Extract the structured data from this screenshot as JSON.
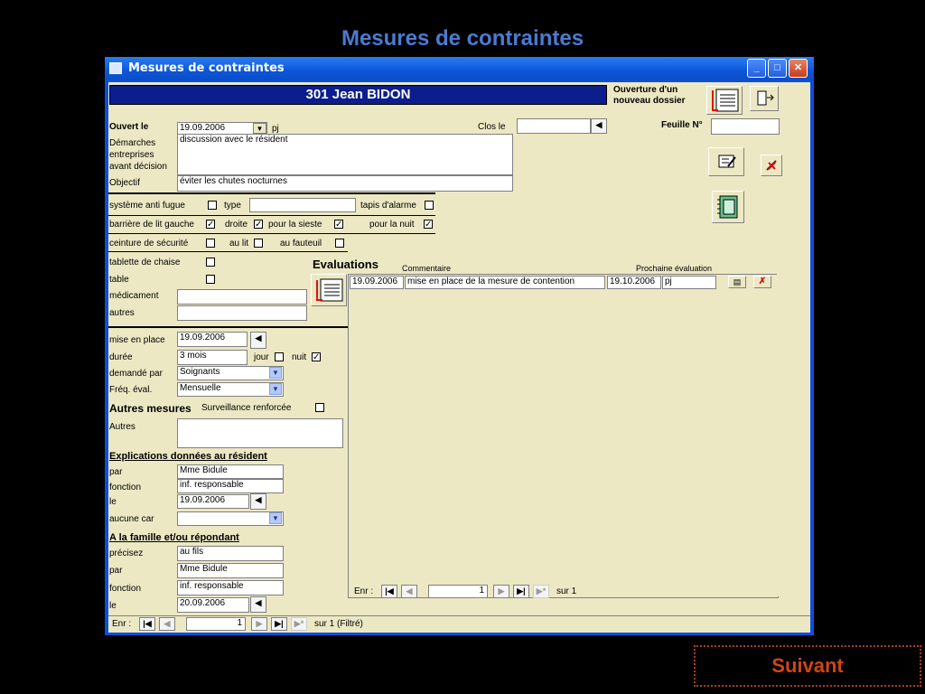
{
  "slide": {
    "title": "Mesures de contraintes",
    "next_label": "Suivant"
  },
  "window": {
    "title": "Mesures de contraintes",
    "min": "_",
    "max": "□",
    "close": "✕"
  },
  "header": {
    "patient": "301  Jean BIDON",
    "new_file_label": "Ouverture d'un nouveau dossier"
  },
  "form": {
    "ouvert_le_label": "Ouvert le",
    "ouvert_le_value": "19.09.2006",
    "pj_label": "pj",
    "clos_le_label": "Clos le",
    "clos_le_value": "",
    "feuille_label": "Feuille N°",
    "feuille_value": "",
    "demarches_label": "Démarches entreprises avant décision",
    "demarches_value": "discussion avec le résident",
    "objectif_label": "Objectif",
    "objectif_value": "éviter les chutes nocturnes",
    "systeme_label": "système anti fugue",
    "type_label": "type",
    "type_value": "",
    "tapis_label": "tapis d'alarme",
    "barriere_label": "barrière de lit gauche",
    "droite_label": "droite",
    "sieste_label": "pour la sieste",
    "nuit_label_1": "pour la nuit",
    "ceinture_label": "ceinture de sécurité",
    "au_lit_label": "au lit",
    "au_fauteuil_label": "au fauteuil",
    "tablette_label": "tablette de chaise",
    "table_label": "table",
    "medicament_label": "médicament",
    "medicament_value": "",
    "autres_label": "autres",
    "autres_value": "",
    "mise_en_place_label": "mise en place",
    "mise_en_place_value": "19.09.2006",
    "duree_label": "durée",
    "duree_value": "3 mois",
    "jour_label": "jour",
    "nuit_label_2": "nuit",
    "demande_label": "demandé par",
    "demande_value": "Soignants",
    "freq_label": "Fréq. éval.",
    "freq_value": "Mensuelle",
    "autres_mesures_label": "Autres mesures",
    "surveillance_label": "Surveillance renforcée",
    "autres2_label": "Autres",
    "autres2_value": "",
    "explications_label": "Explications données au résident",
    "par_label": "par",
    "par_value": "Mme Bidule",
    "fonction_label": "fonction",
    "fonction_value": "inf. responsable",
    "le_label": "le",
    "le_value": "19.09.2006",
    "aucune_label": "aucune  car",
    "aucune_value": "",
    "famille_label": "A la famille et/ou répondant",
    "precisez_label": "précisez",
    "precisez_value": "au fils",
    "par2_label": "par",
    "par2_value": "Mme Bidule",
    "fonction2_label": "fonction",
    "fonction2_value": "inf. responsable",
    "le2_label": "le",
    "le2_value": "20.09.2006"
  },
  "checks": {
    "systeme": false,
    "tapis": false,
    "barriere": true,
    "droite": true,
    "sieste": true,
    "nuit1": true,
    "ceinture": false,
    "au_lit": false,
    "au_fauteuil": false,
    "tablette": false,
    "table": false,
    "jour": false,
    "nuit2": true,
    "surveillance": false
  },
  "evaluations": {
    "title": "Evaluations",
    "col_commentaire": "Commentaire",
    "col_prochaine": "Prochaine évaluation",
    "rows": [
      {
        "date": "19.09.2006",
        "comment": "mise en place de la mesure de contention",
        "next": "19.10.2006",
        "pj": "pj"
      }
    ],
    "nav": {
      "label": "Enr :",
      "current": "1",
      "of": "sur  1"
    }
  },
  "main_nav": {
    "label": "Enr :",
    "current": "1",
    "of": "sur  1 (Filtré)"
  }
}
